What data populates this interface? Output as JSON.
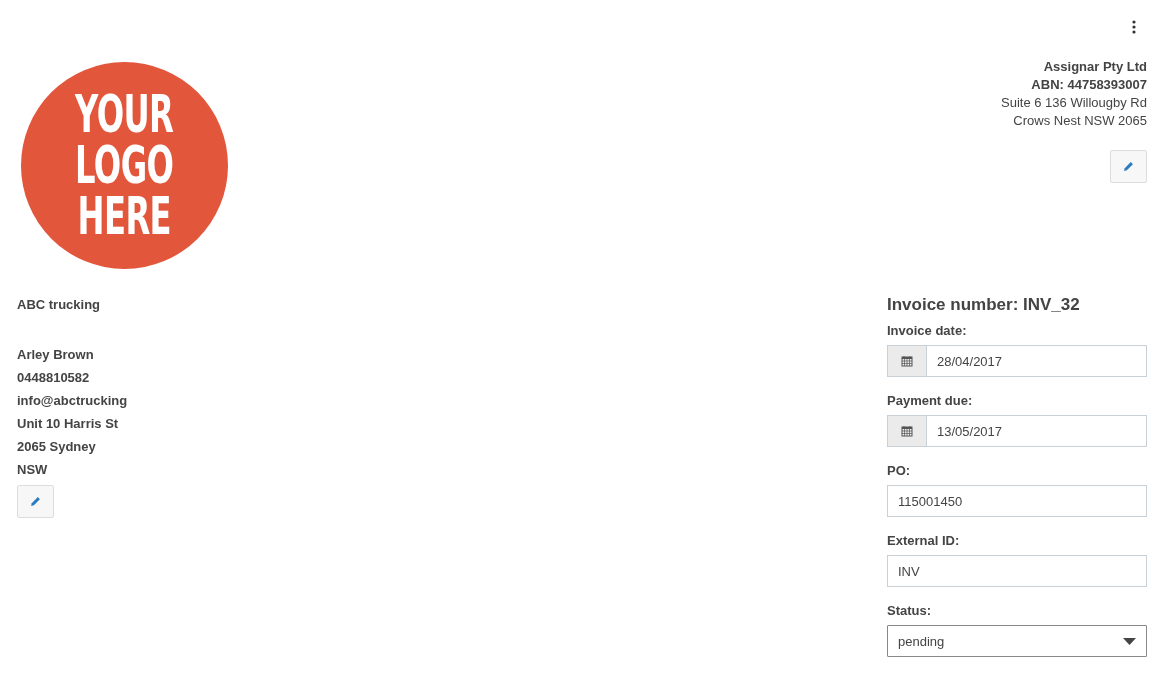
{
  "logo": {
    "text": [
      "YOUR",
      "LOGO",
      "HERE"
    ]
  },
  "company": {
    "name": "Assignar Pty Ltd",
    "abn": "ABN: 44758393007",
    "address": [
      "Suite 6 136 Willougby Rd",
      "Crows Nest NSW 2065"
    ]
  },
  "customer": {
    "company": "ABC trucking",
    "details": [
      "Arley Brown",
      "0448810582",
      "info@abctrucking",
      "Unit 10 Harris St",
      "2065 Sydney",
      "NSW"
    ]
  },
  "invoice": {
    "heading": "Invoice number: INV_32",
    "fields": [
      {
        "kind": "date",
        "label": "Invoice date:",
        "value": "28/04/2017"
      },
      {
        "kind": "date",
        "label": "Payment due:",
        "value": "13/05/2017"
      },
      {
        "kind": "text",
        "label": "PO:",
        "value": "115001450"
      },
      {
        "kind": "text",
        "label": "External ID:",
        "value": "INV"
      },
      {
        "kind": "select",
        "label": "Status:",
        "value": "pending"
      }
    ]
  }
}
